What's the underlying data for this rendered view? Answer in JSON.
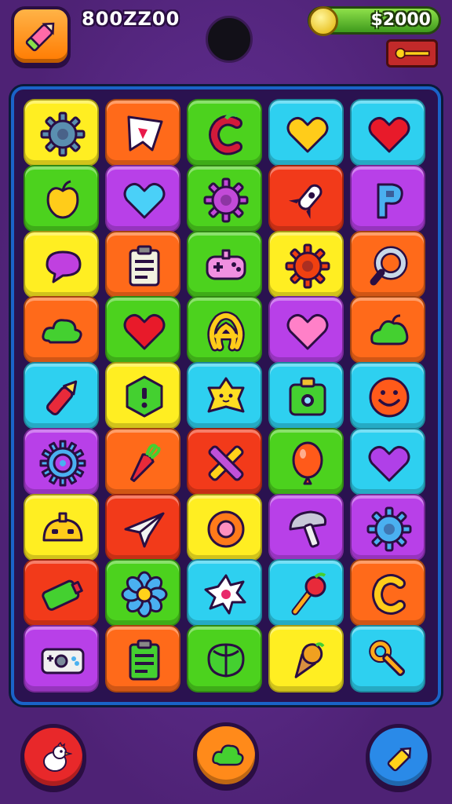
{
  "hud": {
    "score": "800ZZ00",
    "coins": "$2000"
  },
  "colors": {
    "yellow": "#ffee22",
    "orange": "#ff6a1a",
    "green": "#4cd21e",
    "cyan": "#2ed0f0",
    "purple": "#b840e8",
    "red": "#f23a1a",
    "board_border": "#1a63c8"
  },
  "board": {
    "columns": 5,
    "rows": 9,
    "tiles": [
      {
        "bg": "yellow",
        "icon": "gear-icon",
        "c": "#5a8fb0"
      },
      {
        "bg": "orange",
        "icon": "flag-icon",
        "c": "#ffffff"
      },
      {
        "bg": "green",
        "icon": "apple-c-icon",
        "c": "#d21a3a"
      },
      {
        "bg": "cyan",
        "icon": "heart-icon",
        "c": "#ffcc1a"
      },
      {
        "bg": "cyan",
        "icon": "heart-icon",
        "c": "#e81a2a"
      },
      {
        "bg": "green",
        "icon": "apple-icon",
        "c": "#ffcc1a"
      },
      {
        "bg": "purple",
        "icon": "heart-icon",
        "c": "#4ad0f8"
      },
      {
        "bg": "green",
        "icon": "gear-icon",
        "c": "#c24ad8"
      },
      {
        "bg": "red",
        "icon": "rocket-icon",
        "c": "#ffffff"
      },
      {
        "bg": "purple",
        "icon": "letter-p-icon",
        "c": "#4ab0f0"
      },
      {
        "bg": "yellow",
        "icon": "speech-bubble-icon",
        "c": "#c040e0"
      },
      {
        "bg": "orange",
        "icon": "clipboard-icon",
        "c": "#f2f2e0"
      },
      {
        "bg": "green",
        "icon": "gamepad-icon",
        "c": "#f090e0"
      },
      {
        "bg": "yellow",
        "icon": "sun-gear-icon",
        "c": "#f04010"
      },
      {
        "bg": "orange",
        "icon": "magnifier-icon",
        "c": "#c8d8e8"
      },
      {
        "bg": "orange",
        "icon": "cloud-icon",
        "c": "#44d030"
      },
      {
        "bg": "green",
        "icon": "heart-icon",
        "c": "#e81a2a"
      },
      {
        "bg": "green",
        "icon": "pretzel-icon",
        "c": "#ffcc1a"
      },
      {
        "bg": "purple",
        "icon": "heart-icon",
        "c": "#ff80c8"
      },
      {
        "bg": "orange",
        "icon": "blob-icon",
        "c": "#44d030"
      },
      {
        "bg": "cyan",
        "icon": "pencil-icon",
        "c": "#e82a3a"
      },
      {
        "bg": "yellow",
        "icon": "hexagon-icon",
        "c": "#44d030"
      },
      {
        "bg": "cyan",
        "icon": "star-face-icon",
        "c": "#ffdd22"
      },
      {
        "bg": "cyan",
        "icon": "camera-icon",
        "c": "#44d030"
      },
      {
        "bg": "cyan",
        "icon": "smiley-icon",
        "c": "#ff5a1a"
      },
      {
        "bg": "purple",
        "icon": "target-icon",
        "c": "#4ab0f0"
      },
      {
        "bg": "orange",
        "icon": "carrot-icon",
        "c": "#e82a3a"
      },
      {
        "bg": "red",
        "icon": "cross-icon",
        "c": "#c050d8"
      },
      {
        "bg": "green",
        "icon": "balloon-icon",
        "c": "#ff5a1a"
      },
      {
        "bg": "cyan",
        "icon": "heart-icon",
        "c": "#b040e8"
      },
      {
        "bg": "yellow",
        "icon": "robot-face-icon",
        "c": "#ffcc1a"
      },
      {
        "bg": "red",
        "icon": "paper-plane-icon",
        "c": "#f2f2f2"
      },
      {
        "bg": "yellow",
        "icon": "donut-icon",
        "c": "#ff7a1a"
      },
      {
        "bg": "purple",
        "icon": "mushroom-icon",
        "c": "#c8c8d8"
      },
      {
        "bg": "purple",
        "icon": "gear-icon",
        "c": "#4ab0f0"
      },
      {
        "bg": "red",
        "icon": "battery-icon",
        "c": "#44d030"
      },
      {
        "bg": "green",
        "icon": "flower-icon",
        "c": "#4ab0f0"
      },
      {
        "bg": "cyan",
        "icon": "splat-icon",
        "c": "#ffffff"
      },
      {
        "bg": "cyan",
        "icon": "cherry-icon",
        "c": "#e82a3a"
      },
      {
        "bg": "orange",
        "icon": "letter-c-icon",
        "c": "#ffcc1a"
      },
      {
        "bg": "purple",
        "icon": "console-icon",
        "c": "#f0f0f0"
      },
      {
        "bg": "orange",
        "icon": "clipboard-icon",
        "c": "#44d030"
      },
      {
        "bg": "green",
        "icon": "shell-icon",
        "c": "#44d030"
      },
      {
        "bg": "yellow",
        "icon": "ice-cream-icon",
        "c": "#f0a020"
      },
      {
        "bg": "cyan",
        "icon": "key-icon",
        "c": "#ffaa1a"
      }
    ]
  },
  "bottom": {
    "left_button": {
      "icon": "chicken-icon",
      "bg": "#e8282a"
    },
    "center_button": {
      "icon": "cloud-icon",
      "bg": "#ff8a1a"
    },
    "right_button": {
      "icon": "pencil-icon",
      "bg": "#2a8ae8"
    }
  }
}
